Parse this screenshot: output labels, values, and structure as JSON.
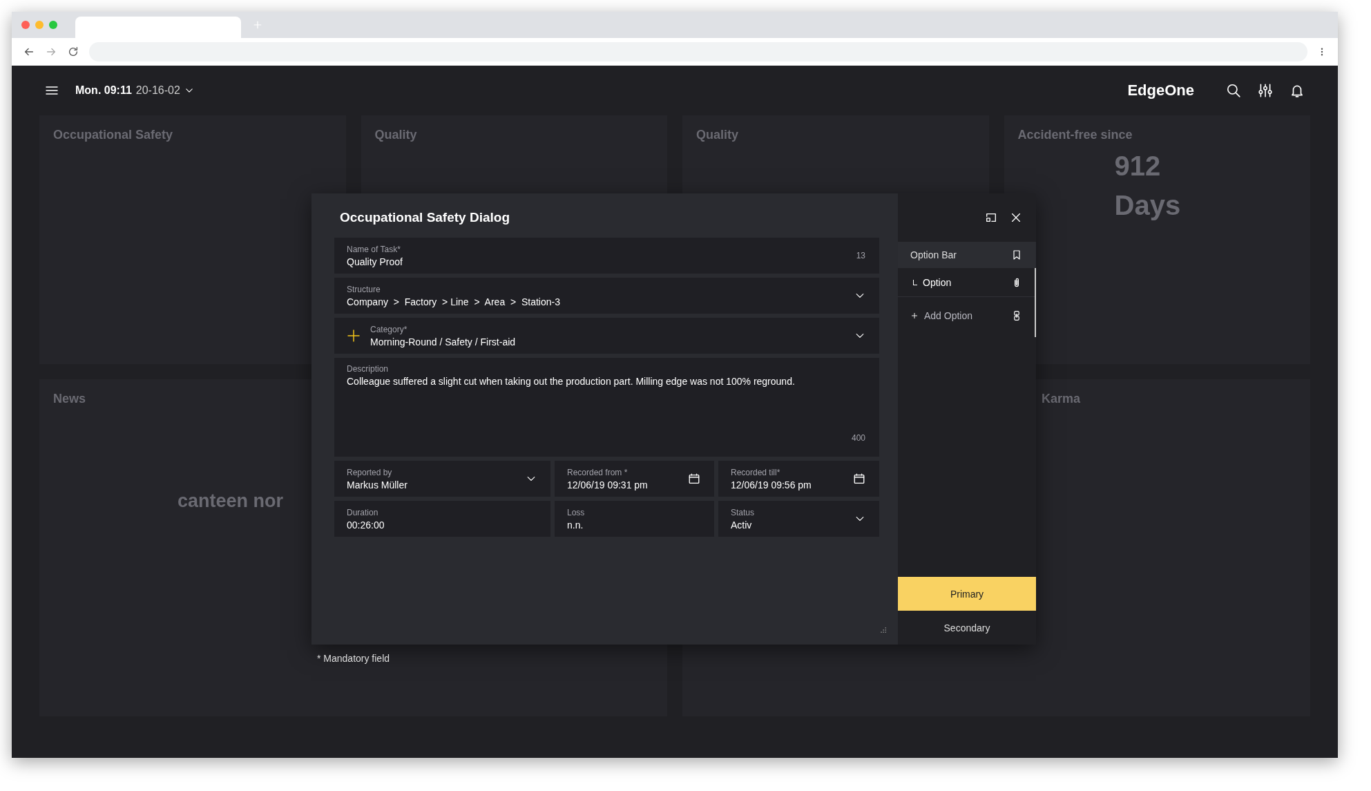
{
  "header": {
    "day_time": "Mon. 09:11",
    "date": "20-16-02",
    "brand": "EdgeOne"
  },
  "background": {
    "tiles": [
      {
        "title": "Occupational Safety"
      },
      {
        "title": "Quality"
      },
      {
        "title": "Quality"
      },
      {
        "title": "Accident-free since",
        "big": "912",
        "big_unit": "Days"
      }
    ],
    "lower": [
      {
        "title": "News",
        "headline": "canteen nor"
      },
      {
        "title": "Karma"
      }
    ]
  },
  "dialog": {
    "title": "Occupational Safety Dialog",
    "rows": [
      [
        {
          "kind": "text",
          "label": "Name of Task*",
          "value": "Quality Proof",
          "counter": "13"
        }
      ],
      [
        {
          "kind": "select",
          "label": "Structure",
          "value": "Company  >  Factory  > Line  >  Area  >  Station-3"
        }
      ],
      [
        {
          "kind": "category",
          "label": "Category*",
          "value": "Morning-Round / Safety / First-aid"
        }
      ],
      [
        {
          "kind": "textarea",
          "label": "Description",
          "value": "Colleague suffered a slight cut when taking out the production part. Milling edge was not 100% reground.",
          "counter": "400"
        }
      ],
      [
        {
          "kind": "select",
          "label": "Reported by",
          "value": "Markus Müller"
        },
        {
          "kind": "date",
          "label": "Recorded from *",
          "value": "12/06/19 09:31 pm"
        },
        {
          "kind": "date",
          "label": "Recorded till*",
          "value": "12/06/19 09:56 pm"
        }
      ],
      [
        {
          "kind": "text",
          "label": "Duration",
          "value": "00:26:00"
        },
        {
          "kind": "text",
          "label": "Loss",
          "value": "n.n."
        },
        {
          "kind": "select",
          "label": "Status",
          "value": "Activ"
        }
      ]
    ],
    "footnote": "* Mandatory field"
  },
  "option_bar": {
    "title": "Option Bar",
    "items": [
      {
        "kind": "option",
        "label": "Option",
        "selected": true
      },
      {
        "kind": "add",
        "label": "Add Option",
        "selected": false
      }
    ],
    "actions": [
      {
        "kind": "primary",
        "label": "Primary"
      },
      {
        "kind": "secondary",
        "label": "Secondary"
      }
    ]
  }
}
